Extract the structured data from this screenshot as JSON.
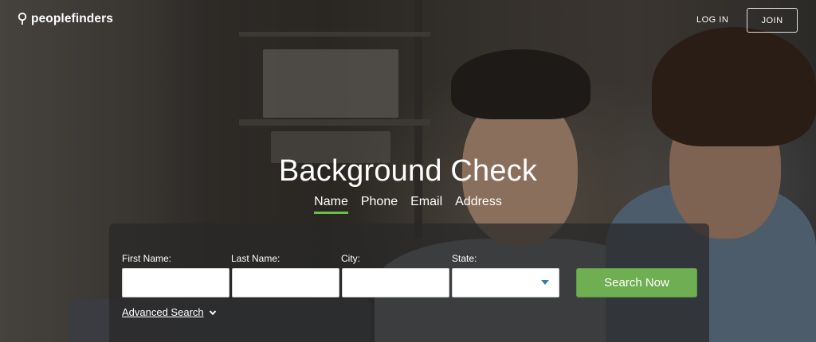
{
  "header": {
    "brand": "peoplefinders",
    "login_label": "LOG IN",
    "join_label": "JOIN"
  },
  "hero": {
    "title": "Background Check",
    "tabs": [
      {
        "label": "Name",
        "active": true
      },
      {
        "label": "Phone",
        "active": false
      },
      {
        "label": "Email",
        "active": false
      },
      {
        "label": "Address",
        "active": false
      }
    ]
  },
  "form": {
    "first_name_label": "First Name:",
    "last_name_label": "Last Name:",
    "city_label": "City:",
    "state_label": "State:",
    "first_name_value": "",
    "last_name_value": "",
    "city_value": "",
    "state_value": "",
    "search_label": "Search Now",
    "advanced_label": "Advanced Search"
  },
  "icons": {
    "logo": "location-pin-icon",
    "state_dropdown": "caret-down-icon",
    "advanced": "chevron-down-icon"
  },
  "colors": {
    "accent": "#6cc04a",
    "button": "#6fae52",
    "caret": "#2b7fb4"
  }
}
